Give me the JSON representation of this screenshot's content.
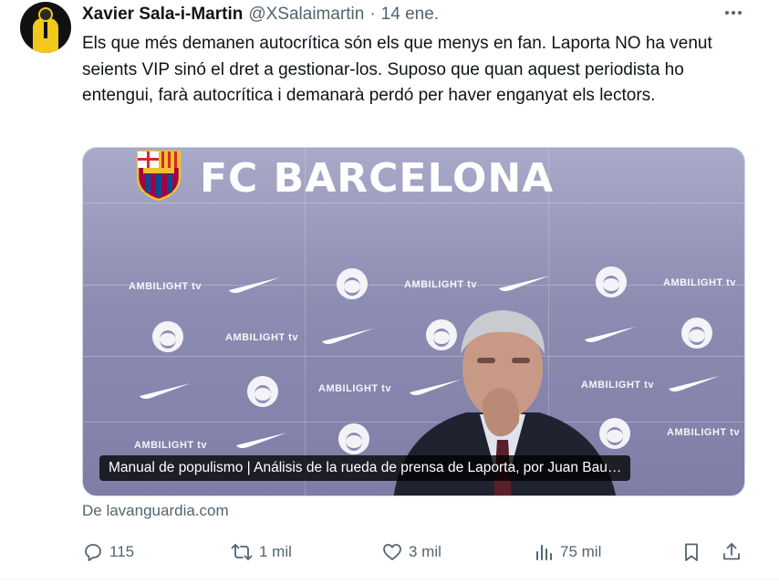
{
  "author": {
    "name": "Xavier Sala-i-Martin",
    "handle": "@XSalaimartin",
    "separator": "·",
    "date": "14 ene."
  },
  "tweet": {
    "text": "Els que més demanen autocrítica són els que menys en fan. Laporta NO ha venut seients VIP sinó el dret a gestionar-los. Suposo que quan aquest periodista ho entengui, farà autocrítica i demanarà perdó per haver enganyat els lectors."
  },
  "card": {
    "backdrop_title": "FC BARCELONA",
    "backdrop_sponsor": "AMBILIGHT tv",
    "caption": "Manual de populismo | Análisis de la rueda de prensa de Laporta, por Juan Bau…",
    "source": "De lavanguardia.com"
  },
  "actions": {
    "replies": "115",
    "reposts": "1 mil",
    "likes": "3 mil",
    "views": "75 mil"
  },
  "icons": {
    "more": "more-horizontal-icon",
    "reply": "reply-icon",
    "repost": "repost-icon",
    "like": "heart-icon",
    "views": "views-icon",
    "bookmark": "bookmark-icon",
    "share": "share-icon"
  },
  "colors": {
    "text": "#0f1419",
    "secondary": "#536471",
    "border": "#cfd9de"
  }
}
